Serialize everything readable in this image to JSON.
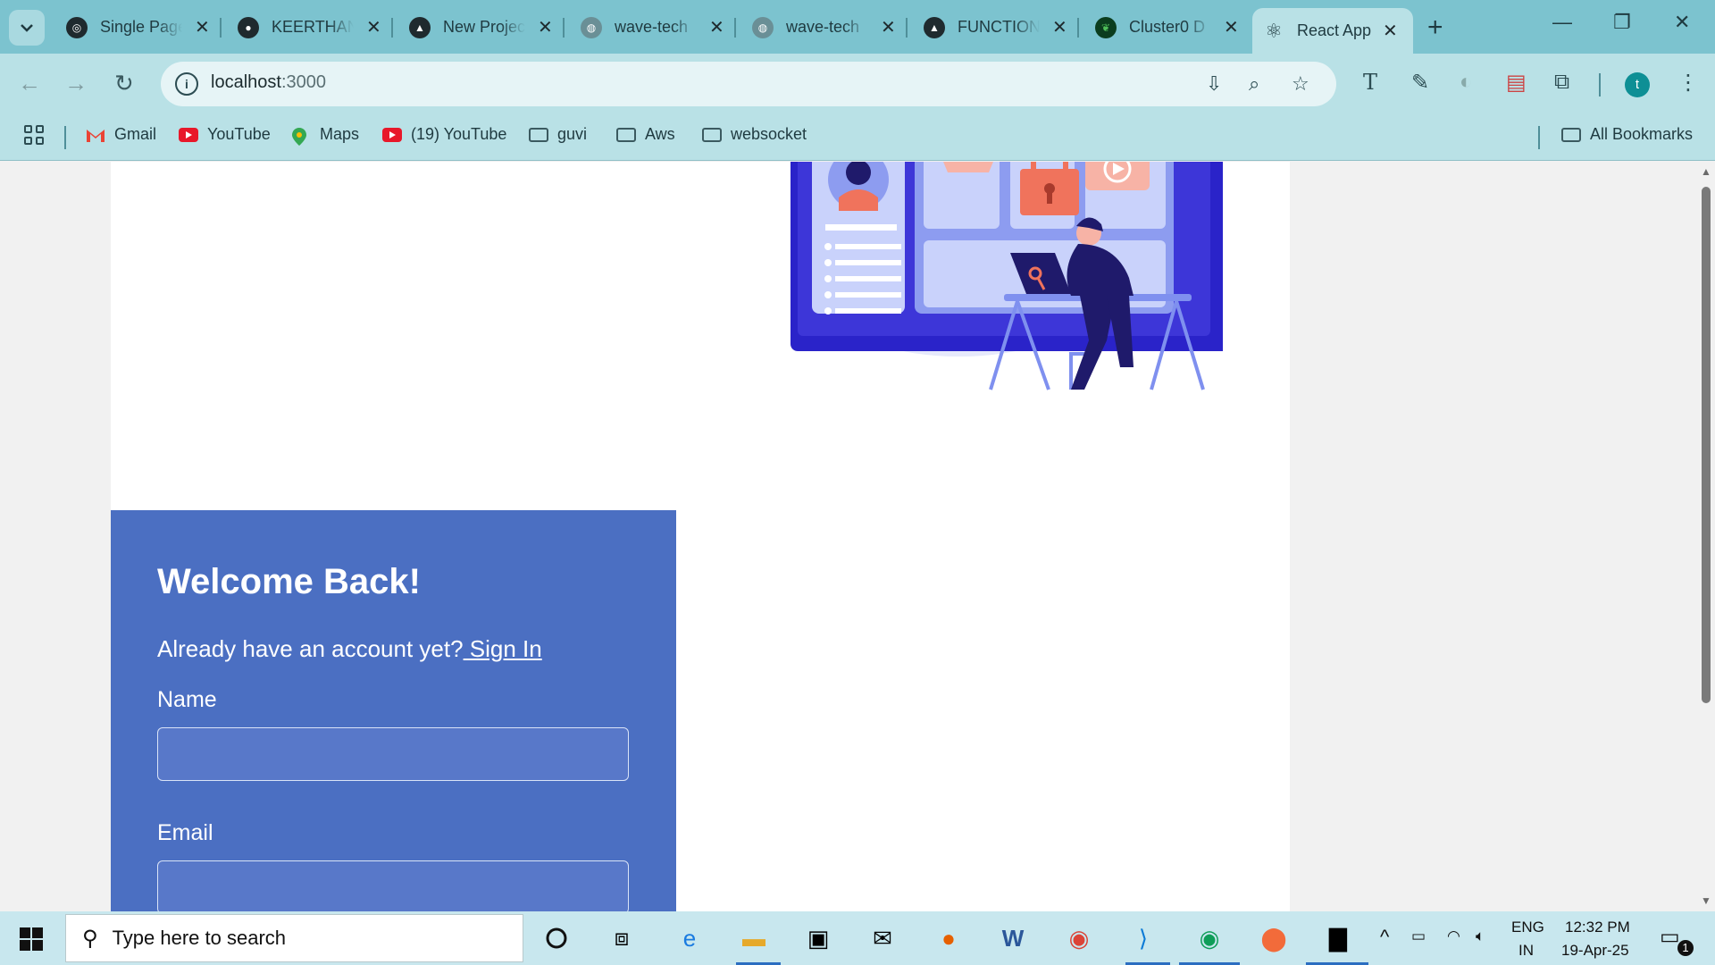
{
  "browser": {
    "tabs": [
      {
        "title": "Single Page",
        "icon": "openai-icon"
      },
      {
        "title": "KEERTHAN",
        "icon": "github-icon"
      },
      {
        "title": "New Project",
        "icon": "vercel-icon"
      },
      {
        "title": "wave-tech",
        "icon": "globe-icon"
      },
      {
        "title": "wave-tech",
        "icon": "globe-icon"
      },
      {
        "title": "FUNCTION",
        "icon": "vercel-icon"
      },
      {
        "title": "Cluster0 D",
        "icon": "mongodb-icon"
      }
    ],
    "active_tab": {
      "title": "React App",
      "icon": "react-icon"
    },
    "url_host": "localhost",
    "url_port": ":3000",
    "profile_initial": "t",
    "bookmarks": [
      {
        "label": "Gmail",
        "icon": "gmail-icon"
      },
      {
        "label": "YouTube",
        "icon": "youtube-icon"
      },
      {
        "label": "Maps",
        "icon": "maps-icon"
      },
      {
        "label": "(19) YouTube",
        "icon": "youtube-icon"
      },
      {
        "label": "guvi",
        "icon": "folder-icon"
      },
      {
        "label": "Aws",
        "icon": "folder-icon"
      },
      {
        "label": "websocket",
        "icon": "folder-icon"
      }
    ],
    "all_bookmarks": "All Bookmarks"
  },
  "page": {
    "heading": "Welcome Back!",
    "prompt": "Already have an account yet?",
    "sign_in_link": " Sign In",
    "name_label": "Name",
    "email_label": "Email",
    "name_value": "",
    "email_value": ""
  },
  "taskbar": {
    "search_placeholder": "Type here to search",
    "lang": "ENG",
    "region": "IN",
    "time": "12:32 PM",
    "date": "19-Apr-25",
    "notification_count": "1"
  },
  "colors": {
    "panel": "#4b6fc2",
    "chrome": "#7cc3cf",
    "toolbar": "#b9e1e6"
  }
}
